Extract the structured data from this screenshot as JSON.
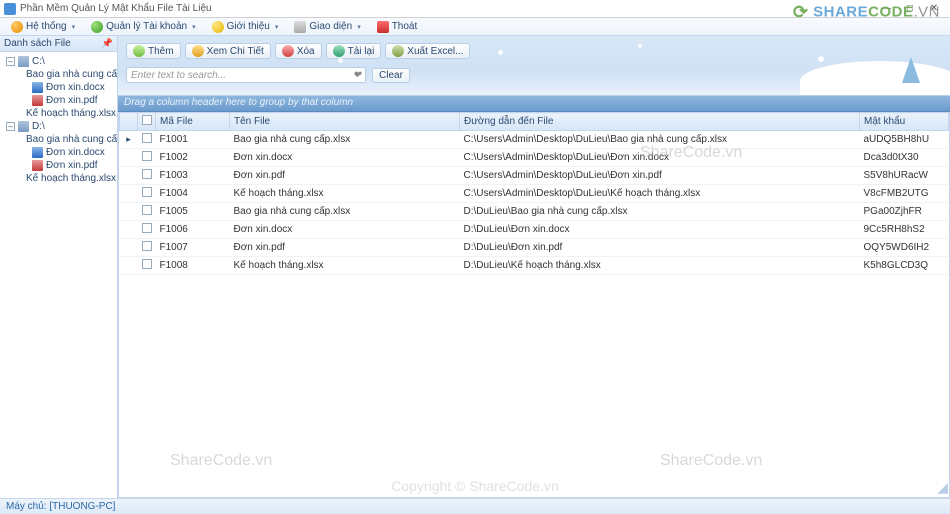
{
  "window": {
    "title": "Phần Mềm Quản Lý Mật Khẩu File Tài Liệu",
    "min": "—",
    "max": "□",
    "close": "✕"
  },
  "menu": {
    "hethong": "Hệ thống",
    "quanly": "Quản lý Tài khoản",
    "gioithieu": "Giới thiệu",
    "giaodien": "Giao diện",
    "thoat": "Thoát"
  },
  "sidebar": {
    "title": "Danh sách File",
    "nodes": {
      "c": "C:\\",
      "c_xlsx": "Bao gia nhà cung cấp.xlsx",
      "c_docx": "Đơn xin.docx",
      "c_pdf": "Đơn xin.pdf",
      "c_kh": "Kế hoạch tháng.xlsx",
      "d": "D:\\",
      "d_xlsx": "Bao gia nhà cung cấp.xlsx",
      "d_docx": "Đơn xin.docx",
      "d_pdf": "Đơn xin.pdf",
      "d_kh": "Kế hoạch tháng.xlsx"
    }
  },
  "toolbar": {
    "them": "Thêm",
    "xemchitiet": "Xem Chi Tiết",
    "xoa": "Xóa",
    "tailai": "Tải lại",
    "xuatexcel": "Xuất Excel..."
  },
  "search": {
    "placeholder": "Enter text to search...",
    "clear": "Clear"
  },
  "grid": {
    "grouphint": "Drag a column header here to group by that column",
    "cols": {
      "ma": "Mã File",
      "ten": "Tên File",
      "dd": "Đường dẫn đến File",
      "mk": "Mật khẩu"
    },
    "rows": [
      {
        "ma": "F1001",
        "ten": "Bao gia nhà cung cấp.xlsx",
        "dd": "C:\\Users\\Admin\\Desktop\\DuLieu\\Bao gia nhà cung cấp.xlsx",
        "mk": "aUDQ5BH8hU"
      },
      {
        "ma": "F1002",
        "ten": "Đơn xin.docx",
        "dd": "C:\\Users\\Admin\\Desktop\\DuLieu\\Đơn xin.docx",
        "mk": "Dca3d0tX30"
      },
      {
        "ma": "F1003",
        "ten": "Đơn xin.pdf",
        "dd": "C:\\Users\\Admin\\Desktop\\DuLieu\\Đơn xin.pdf",
        "mk": "S5V8hURacW"
      },
      {
        "ma": "F1004",
        "ten": "Kế hoạch tháng.xlsx",
        "dd": "C:\\Users\\Admin\\Desktop\\DuLieu\\Kế hoạch tháng.xlsx",
        "mk": "V8cFMB2UTG"
      },
      {
        "ma": "F1005",
        "ten": "Bao gia nhà cung cấp.xlsx",
        "dd": "D:\\DuLieu\\Bao gia nhà cung cấp.xlsx",
        "mk": "PGa00ZjhFR"
      },
      {
        "ma": "F1006",
        "ten": "Đơn xin.docx",
        "dd": "D:\\DuLieu\\Đơn xin.docx",
        "mk": "9Cc5RH8hS2"
      },
      {
        "ma": "F1007",
        "ten": "Đơn xin.pdf",
        "dd": "D:\\DuLieu\\Đơn xin.pdf",
        "mk": "OQY5WD6IH2"
      },
      {
        "ma": "F1008",
        "ten": "Kế hoạch tháng.xlsx",
        "dd": "D:\\DuLieu\\Kế hoạch tháng.xlsx",
        "mk": "K5h8GLCD3Q"
      }
    ]
  },
  "status": {
    "text": "Máy chủ: [THUONG-PC]"
  },
  "watermark": {
    "brand_share": "SHARE",
    "brand_code": "CODE",
    "brand_vn": ".VN",
    "sc": "ShareCode.vn",
    "copyright": "Copyright © ShareCode.vn"
  }
}
